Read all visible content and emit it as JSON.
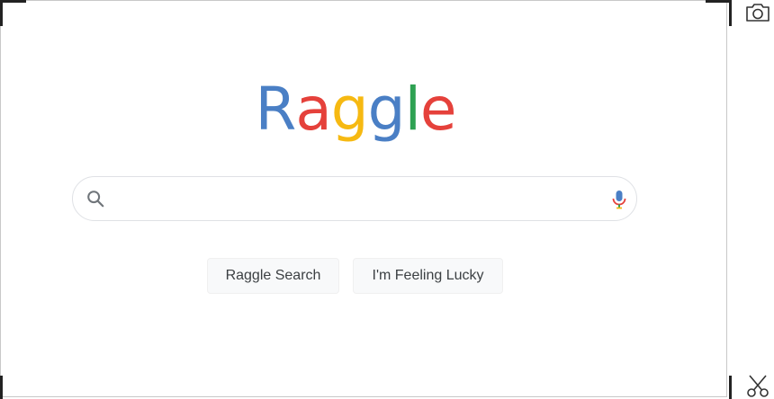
{
  "logo": {
    "letters": [
      {
        "char": "R",
        "color": "#4a7fc5"
      },
      {
        "char": "a",
        "color": "#e5413b"
      },
      {
        "char": "g",
        "color": "#f6b912"
      },
      {
        "char": "g",
        "color": "#4a7fc5"
      },
      {
        "char": "l",
        "color": "#2ea152"
      },
      {
        "char": "e",
        "color": "#e5413b"
      }
    ]
  },
  "search": {
    "value": "",
    "placeholder": "",
    "icon": "search-icon",
    "voice_icon": "microphone-icon"
  },
  "buttons": {
    "search_label": "Raggle Search",
    "lucky_label": "I'm Feeling Lucky"
  },
  "capture_tools": {
    "screenshot_icon": "camera-icon",
    "snip_icon": "scissors-icon"
  },
  "colors": {
    "blue": "#4a7fc5",
    "red": "#e5413b",
    "yellow": "#f6b912",
    "green": "#2ea152",
    "button_bg": "#f8f9fa",
    "button_text": "#3c4043"
  }
}
